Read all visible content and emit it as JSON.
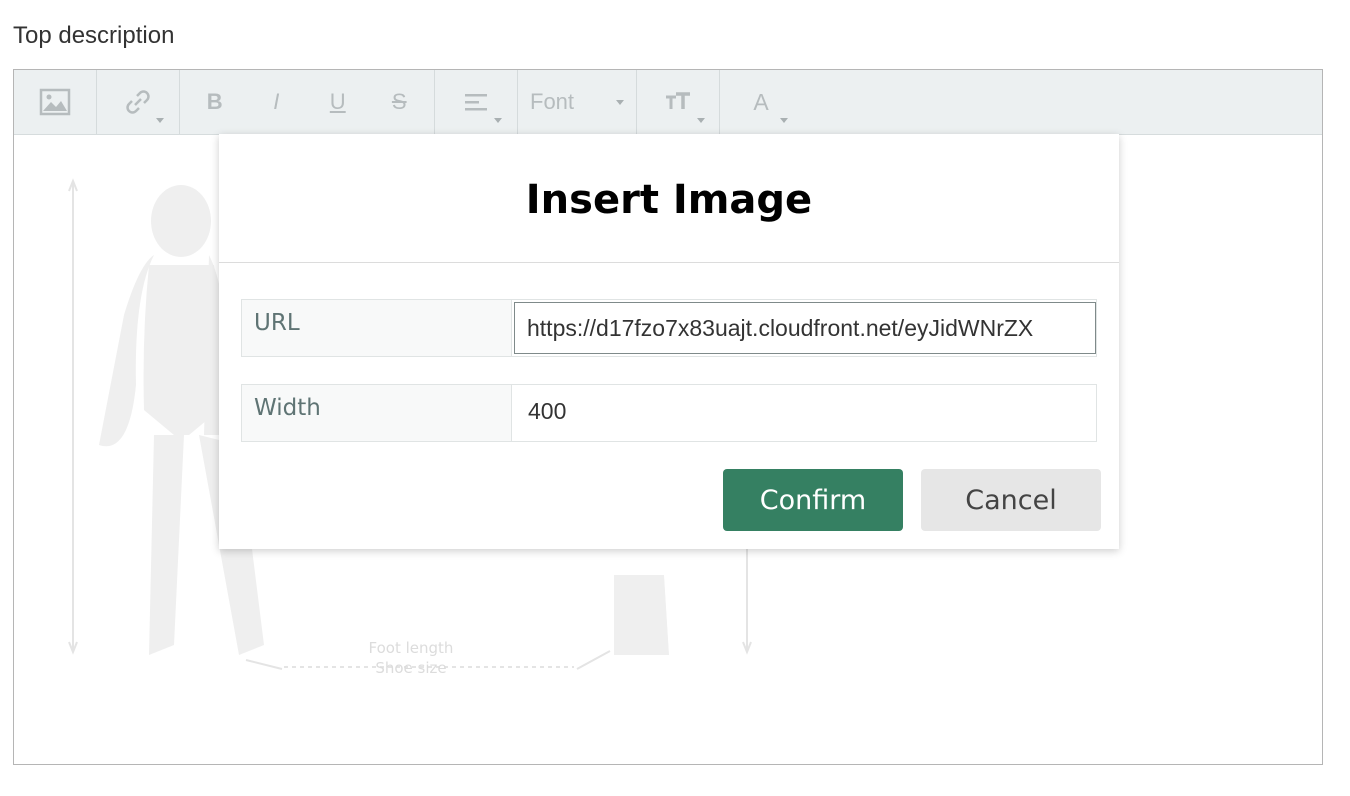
{
  "field": {
    "label": "Top description"
  },
  "toolbar": {
    "font_label": "Font",
    "bold": "B",
    "italic": "I",
    "underline": "U",
    "strike": "S",
    "color": "A",
    "icons": [
      "image-icon",
      "link-icon",
      "bold-icon",
      "italic-icon",
      "underline-icon",
      "strikethrough-icon",
      "align-icon",
      "font-dropdown",
      "font-size-icon",
      "font-color-icon"
    ]
  },
  "background_image": {
    "annotations": [
      "Foot length",
      "Shoe size"
    ]
  },
  "modal": {
    "title": "Insert Image",
    "url_label": "URL",
    "url_value": "https://d17fzo7x83uajt.cloudfront.net/eyJidWNrZX",
    "width_label": "Width",
    "width_value": "400",
    "confirm_label": "Confirm",
    "cancel_label": "Cancel"
  },
  "colors": {
    "confirm": "#358062",
    "cancel": "#e6e6e6",
    "toolbar": "#ecf0f1"
  }
}
